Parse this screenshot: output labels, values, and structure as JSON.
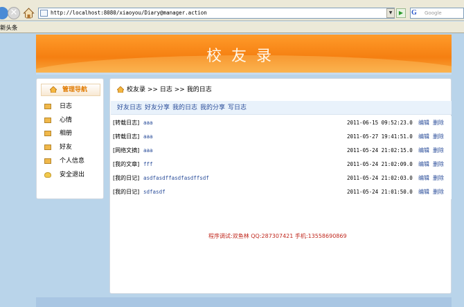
{
  "browser": {
    "address": "http://localhost:8080/xiaoyou/Diary@manager.action",
    "search_placeholder": "Google",
    "favorites_label": "新头条"
  },
  "site": {
    "title": "校友录",
    "banner_color": "#f58a1c"
  },
  "sidebar": {
    "heading": "管理导航",
    "items": [
      {
        "label": "日志",
        "icon": "folder-icon"
      },
      {
        "label": "心情",
        "icon": "folder-icon"
      },
      {
        "label": "相册",
        "icon": "folder-icon"
      },
      {
        "label": "好友",
        "icon": "folder-icon"
      },
      {
        "label": "个人信息",
        "icon": "folder-icon"
      },
      {
        "label": "安全退出",
        "icon": "lamp-icon"
      }
    ]
  },
  "breadcrumb": {
    "home": "校友录",
    "sep": ">>",
    "level1": "日志",
    "level2": "我的日志"
  },
  "tabs": [
    "好友日志",
    "好友分享",
    "我的日志",
    "我的分享",
    "写日志"
  ],
  "diary_rows": [
    {
      "type": "[转载日志]",
      "title": "aaa",
      "date": "2011-06-15 09:52:23.0",
      "edit": "编辑",
      "delete": "删除"
    },
    {
      "type": "[转载日志]",
      "title": "aaa",
      "date": "2011-05-27 19:41:51.0",
      "edit": "编辑",
      "delete": "删除"
    },
    {
      "type": "[网络文摘]",
      "title": "aaa",
      "date": "2011-05-24 21:02:15.0",
      "edit": "编辑",
      "delete": "删除"
    },
    {
      "type": "[我的文章]",
      "title": "fff",
      "date": "2011-05-24 21:02:09.0",
      "edit": "编辑",
      "delete": "删除"
    },
    {
      "type": "[我的日记]",
      "title": "asdfasdffasdfasdffsdf",
      "date": "2011-05-24 21:02:03.0",
      "edit": "编辑",
      "delete": "删除"
    },
    {
      "type": "[我的日记]",
      "title": "sdfasdf",
      "date": "2011-05-24 21:01:50.0",
      "edit": "编辑",
      "delete": "删除"
    }
  ],
  "footer": "程序调试:双鱼林 QQ:287307421 手机:13558690869"
}
